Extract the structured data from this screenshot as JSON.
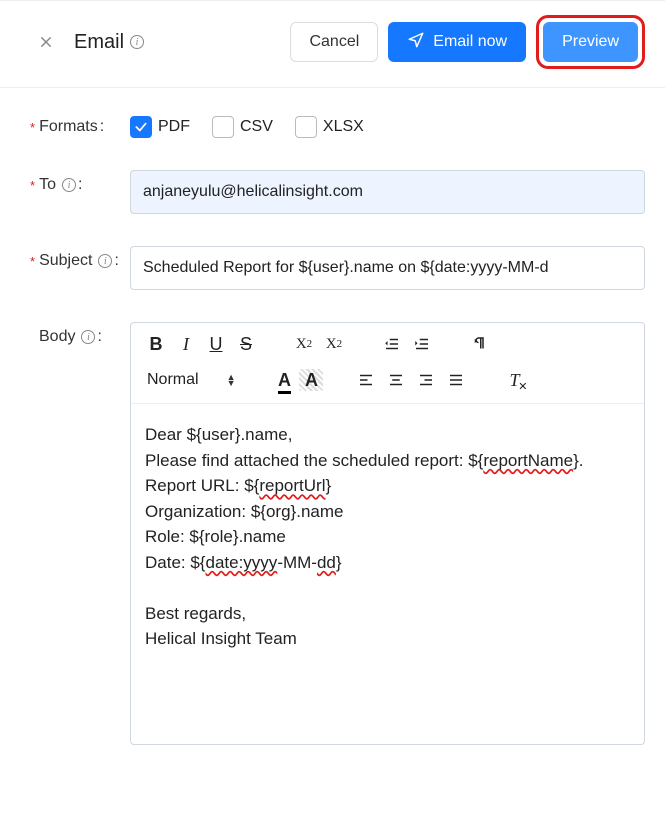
{
  "header": {
    "title": "Email",
    "cancel_label": "Cancel",
    "email_now_label": "Email now",
    "preview_label": "Preview"
  },
  "labels": {
    "formats": "Formats",
    "to": "To",
    "subject": "Subject",
    "body": "Body"
  },
  "formats": {
    "pdf": {
      "label": "PDF",
      "checked": true
    },
    "csv": {
      "label": "CSV",
      "checked": false
    },
    "xlsx": {
      "label": "XLSX",
      "checked": false
    }
  },
  "to_value": "anjaneyulu@helicalinsight.com",
  "subject_value": "Scheduled Report for ${user}.name on ${date:yyyy-MM-d",
  "toolbar": {
    "heading_select": "Normal"
  },
  "body_lines": {
    "l1a": "Dear ${user}.name,",
    "l2a": "Please find attached the scheduled report: ${",
    "l2b": "reportName",
    "l2c": "}.",
    "l3a": "Report URL: ${",
    "l3b": "reportUrl",
    "l3c": "}",
    "l4a": "Organization: ${org}.name",
    "l5a": "Role: ${role}.name",
    "l6a": "Date: ${",
    "l6b": "date:yyyy",
    "l6c": "-MM-",
    "l6d": "dd",
    "l6e": "}",
    "l7": "Best regards,",
    "l8": "Helical Insight Team"
  }
}
